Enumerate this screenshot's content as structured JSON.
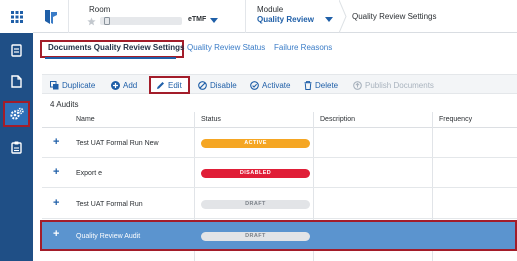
{
  "header": {
    "room_label": "Room",
    "room_value": "eTMF",
    "module_label": "Module",
    "module_value": "Quality Review",
    "page_title": "Quality Review Settings"
  },
  "tabs": [
    {
      "label": "Documents Quality Review Settings",
      "active": true
    },
    {
      "label": "Quality Review Status",
      "active": false
    },
    {
      "label": "Failure Reasons",
      "active": false
    }
  ],
  "toolbar": {
    "duplicate": "Duplicate",
    "add": "Add",
    "edit": "Edit",
    "disable": "Disable",
    "activate": "Activate",
    "delete": "Delete",
    "publish": "Publish Documents"
  },
  "audit_count": "4 Audits",
  "table": {
    "columns": [
      "Name",
      "Status",
      "Description",
      "Frequency"
    ],
    "rows": [
      {
        "name": "Test UAT Formal Run New",
        "status": "ACTIVE",
        "status_type": "active"
      },
      {
        "name": "Export e",
        "status": "DISABLED",
        "status_type": "disabled"
      },
      {
        "name": "Test UAT Formal Run",
        "status": "DRAFT",
        "status_type": "draft"
      },
      {
        "name": "Quality Review Audit",
        "status": "DRAFT",
        "status_type": "draft",
        "selected": true
      }
    ]
  },
  "colors": {
    "rail": "#1f4f86",
    "accent": "#1f5fa8",
    "highlight": "#a31d2a",
    "selected_row": "#5b94cf",
    "status_active": "#f5a623",
    "status_disabled": "#e01e37",
    "status_draft": "#e2e4e7"
  }
}
